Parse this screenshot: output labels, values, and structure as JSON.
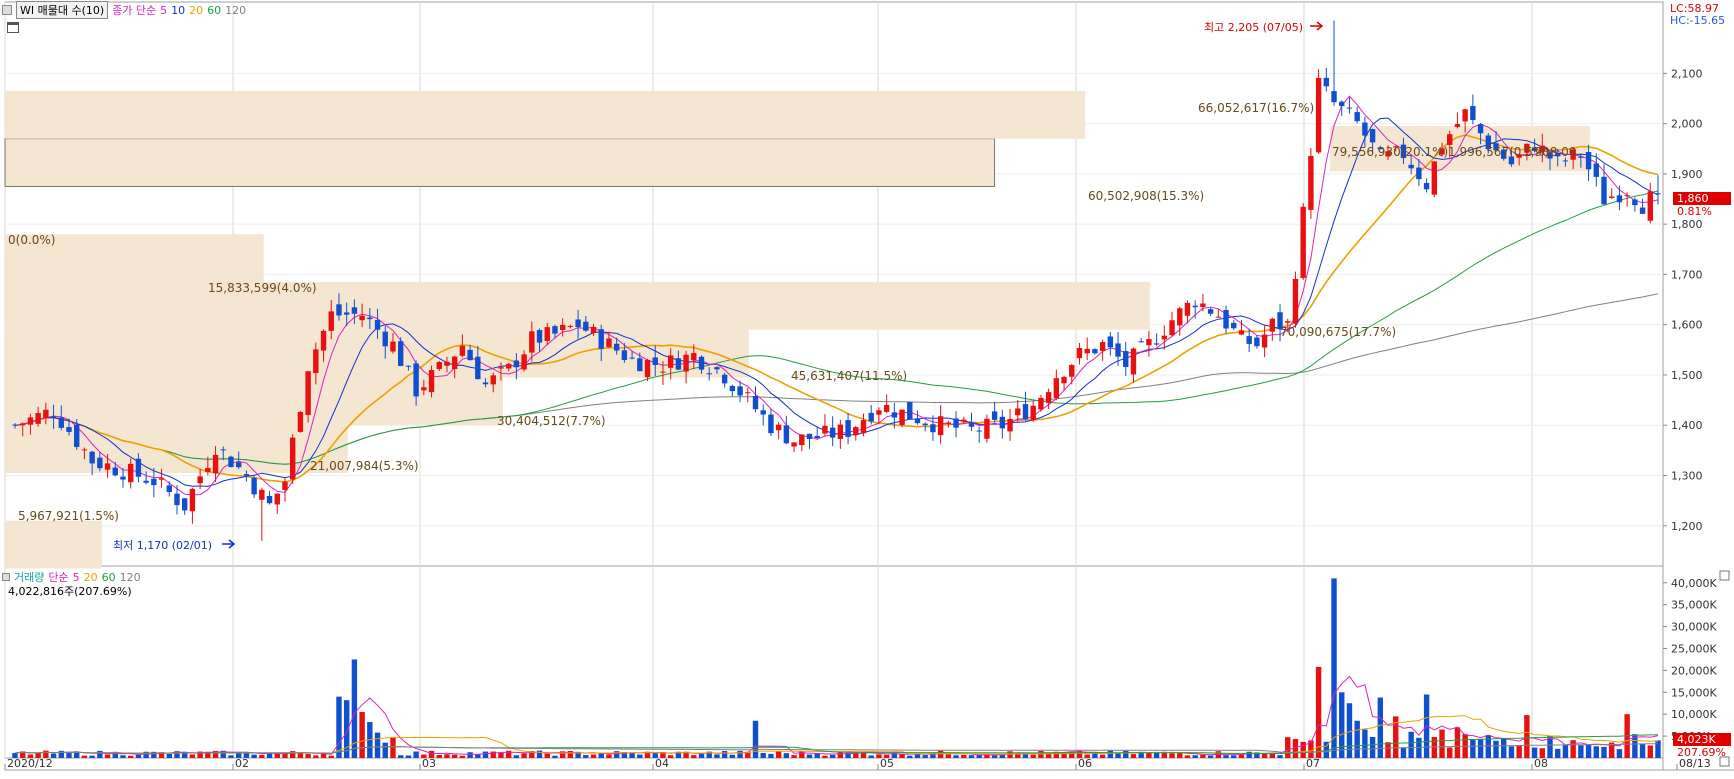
{
  "header": {
    "title_box": "WI 매물대 수(10)",
    "ma_label": "종가 단순",
    "ma_periods": [
      "5",
      "10",
      "20",
      "60",
      "120"
    ],
    "ma_colors": [
      "#e020c0",
      "#1030d0",
      "#f0a000",
      "#20a040",
      "#808080"
    ],
    "lc_label": "LC:58.97",
    "hc_label": "HC:-15.65",
    "lc_color": "#e00000",
    "hc_color": "#2060e0"
  },
  "volume_header": {
    "label": "거래량",
    "ma_label": "단순",
    "ma_periods": [
      "5",
      "20",
      "60",
      "120"
    ],
    "current": "4,022,816주(207.69%)"
  },
  "annotations": {
    "high": "최고 2,205 (07/05)",
    "low": "최저 1,170 (02/01)"
  },
  "current_price": {
    "price": "1,860",
    "change": "0.81%"
  },
  "current_volume": {
    "value": "4,023K",
    "change": "207.69%"
  },
  "chart_data": {
    "type": "candlestick",
    "price_axis": {
      "ylim": [
        1120,
        2230
      ],
      "ticks": [
        "2,100",
        "2,000",
        "1,900",
        "1,800",
        "1,700",
        "1,600",
        "1,500",
        "1,400",
        "1,300",
        "1,200"
      ],
      "tick_values": [
        2100,
        2000,
        1900,
        1800,
        1700,
        1600,
        1500,
        1400,
        1300,
        1200
      ]
    },
    "volume_axis": {
      "ylim": [
        0,
        42000
      ],
      "ticks": [
        "40,000K",
        "35,000K",
        "30,000K",
        "25,000K",
        "20,000K",
        "15,000K",
        "10,000K",
        "5,000K"
      ],
      "tick_values": [
        40000,
        35000,
        30000,
        25000,
        20000,
        15000,
        10000,
        5000
      ],
      "unit": "K"
    },
    "x_axis_labels": [
      "2020/12",
      "02",
      "03",
      "04",
      "05",
      "06",
      "07",
      "08",
      "08/13"
    ],
    "volume_profile": [
      {
        "label": "5,967,921(1.5%)",
        "pmin": 1115,
        "pmax": 1210,
        "pct": 1.5
      },
      {
        "label": "0(0.0%)",
        "pmin": 1210,
        "pmax": 1305,
        "pct": 0.0
      },
      {
        "label": "21,007,984(5.3%)",
        "pmin": 1305,
        "pmax": 1400,
        "pct": 5.3
      },
      {
        "label": "30,404,512(7.7%)",
        "pmin": 1400,
        "pmax": 1495,
        "pct": 7.7
      },
      {
        "label": "45,631,407(11.5%)",
        "pmin": 1495,
        "pmax": 1590,
        "pct": 11.5
      },
      {
        "label": "70,090,675(17.7%)",
        "pmin": 1590,
        "pmax": 1685,
        "pct": 17.7
      },
      {
        "label": "15,833,599(4.0%)",
        "pmin": 1685,
        "pmax": 1780,
        "pct": 4.0
      },
      {
        "label": "0(0.0%)",
        "pmin": 1780,
        "pmax": 1875,
        "pct": 0.0
      },
      {
        "label": "60,502,908(15.3%)",
        "pmin": 1875,
        "pmax": 1970,
        "pct": 15.3
      },
      {
        "label": "66,052,617(16.7%)",
        "pmin": 1970,
        "pmax": 2065,
        "pct": 16.7
      },
      {
        "label": "79,556,930(20.1%)",
        "pmin": 1905,
        "pmax": 1995,
        "pct": 20.1
      },
      {
        "label": "1,996,567(0.5%)",
        "pmin": 1905,
        "pmax": 1995,
        "pct": 0.5
      },
      {
        "label": "1,908.00",
        "pmin": 1905,
        "pmax": 1995,
        "pct": 0
      }
    ],
    "anchors": [
      [
        0,
        1400
      ],
      [
        5,
        1430
      ],
      [
        10,
        1330
      ],
      [
        14,
        1310
      ],
      [
        18,
        1290
      ],
      [
        22,
        1240
      ],
      [
        26,
        1360
      ],
      [
        30,
        1300
      ],
      [
        33,
        1240
      ],
      [
        35,
        1290
      ],
      [
        38,
        1520
      ],
      [
        41,
        1620
      ],
      [
        45,
        1620
      ],
      [
        49,
        1560
      ],
      [
        52,
        1470
      ],
      [
        55,
        1510
      ],
      [
        58,
        1560
      ],
      [
        61,
        1480
      ],
      [
        64,
        1510
      ],
      [
        67,
        1570
      ],
      [
        70,
        1580
      ],
      [
        73,
        1600
      ],
      [
        76,
        1570
      ],
      [
        80,
        1530
      ],
      [
        84,
        1520
      ],
      [
        88,
        1540
      ],
      [
        92,
        1500
      ],
      [
        95,
        1450
      ],
      [
        98,
        1400
      ],
      [
        101,
        1370
      ],
      [
        105,
        1380
      ],
      [
        108,
        1390
      ],
      [
        112,
        1440
      ],
      [
        116,
        1420
      ],
      [
        120,
        1400
      ],
      [
        124,
        1390
      ],
      [
        128,
        1400
      ],
      [
        132,
        1440
      ],
      [
        135,
        1500
      ],
      [
        138,
        1540
      ],
      [
        141,
        1560
      ],
      [
        144,
        1520
      ],
      [
        147,
        1560
      ],
      [
        150,
        1610
      ],
      [
        153,
        1650
      ],
      [
        156,
        1620
      ],
      [
        159,
        1570
      ],
      [
        161,
        1560
      ],
      [
        163,
        1600
      ],
      [
        165,
        1600
      ],
      [
        167,
        1820
      ],
      [
        169,
        2080
      ],
      [
        171,
        2040
      ],
      [
        174,
        2000
      ],
      [
        177,
        1930
      ],
      [
        180,
        1940
      ],
      [
        183,
        1880
      ],
      [
        185,
        1960
      ],
      [
        188,
        2020
      ],
      [
        191,
        1960
      ],
      [
        194,
        1920
      ],
      [
        197,
        1960
      ],
      [
        200,
        1920
      ],
      [
        203,
        1940
      ],
      [
        206,
        1850
      ],
      [
        209,
        1870
      ],
      [
        211,
        1840
      ],
      [
        213,
        1860
      ]
    ],
    "volume_spikes": {
      "42": 14000,
      "43": 13200,
      "44": 22500,
      "45": 10500,
      "46": 8200,
      "47": 5800,
      "48": 3500,
      "49": 4600,
      "96": 8500,
      "169": 20800,
      "171": 41000,
      "172": 15000,
      "173": 12500,
      "174": 8500,
      "175": 6500,
      "177": 13800,
      "179": 9500,
      "181": 6000,
      "183": 14500,
      "185": 6500,
      "187": 7000,
      "196": 9800,
      "209": 10000,
      "213": 4023
    },
    "high_point": {
      "index": 171,
      "value": 2205
    },
    "low_point": {
      "index": 32,
      "value": 1170
    },
    "last_close": 1860
  }
}
